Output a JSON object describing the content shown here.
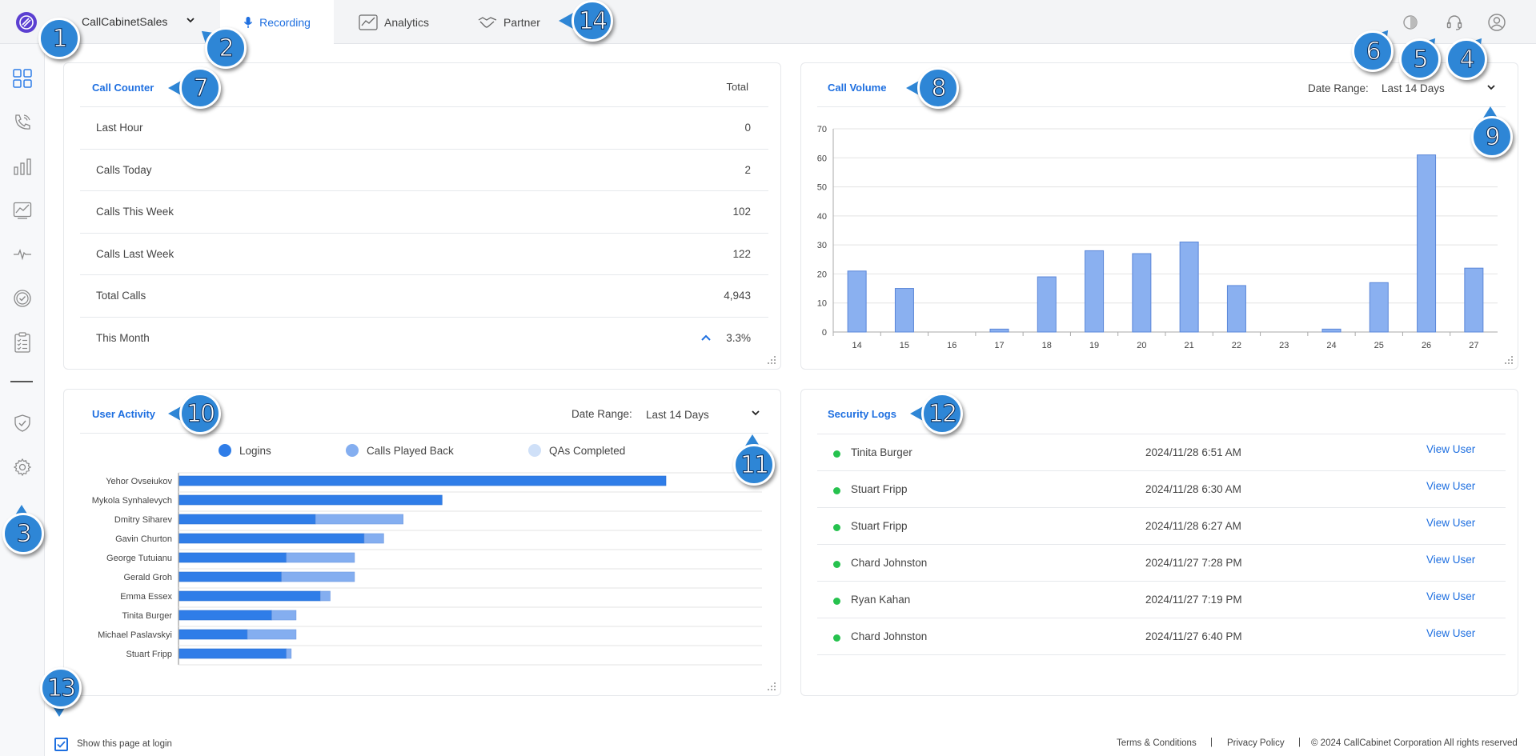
{
  "header": {
    "org_name": "CallCabinetSales",
    "tabs": [
      {
        "label": "Recording",
        "icon": "microphone-icon",
        "active": true
      },
      {
        "label": "Analytics",
        "icon": "analytics-chart-icon",
        "active": false
      },
      {
        "label": "Partner",
        "icon": "handshake-icon",
        "active": false
      }
    ],
    "right_icons": [
      "theme-toggle-icon",
      "headset-support-icon",
      "user-account-icon"
    ]
  },
  "sidebar": {
    "items": [
      "dashboard-grid-icon",
      "phone-calls-icon",
      "bar-chart-icon",
      "trend-chart-icon",
      "pulse-icon",
      "check-circle-icon",
      "checklist-icon",
      "shield-check-icon",
      "settings-gear-icon"
    ]
  },
  "call_counter": {
    "title": "Call Counter",
    "total_header": "Total",
    "rows": [
      {
        "label": "Last Hour",
        "value": "0"
      },
      {
        "label": "Calls Today",
        "value": "2"
      },
      {
        "label": "Calls This Week",
        "value": "102"
      },
      {
        "label": "Calls Last Week",
        "value": "122"
      },
      {
        "label": "Total Calls",
        "value": "4,943"
      },
      {
        "label": "This Month",
        "value": "3.3%",
        "trend": "up"
      }
    ]
  },
  "call_volume": {
    "title": "Call Volume",
    "date_range_label": "Date Range:",
    "date_range_value": "Last 14 Days"
  },
  "user_activity": {
    "title": "User Activity",
    "date_range_label": "Date Range:",
    "date_range_value": "Last 14 Days",
    "legend": [
      {
        "label": "Logins",
        "color": "#2f7de8"
      },
      {
        "label": "Calls Played Back",
        "color": "#84aef0"
      },
      {
        "label": "QAs Completed",
        "color": "#cfe0f8"
      }
    ]
  },
  "security_logs": {
    "title": "Security Logs",
    "link_label": "View User",
    "rows": [
      {
        "name": "Tinita Burger",
        "date": "2024/11/28 6:51 AM"
      },
      {
        "name": "Stuart Fripp",
        "date": "2024/11/28 6:30 AM"
      },
      {
        "name": "Stuart Fripp",
        "date": "2024/11/28 6:27 AM"
      },
      {
        "name": "Chard Johnston",
        "date": "2024/11/27 7:28 PM"
      },
      {
        "name": "Ryan Kahan",
        "date": "2024/11/27 7:19 PM"
      },
      {
        "name": "Chard Johnston",
        "date": "2024/11/27 6:40 PM"
      }
    ]
  },
  "footer": {
    "show_at_login": "Show this page at login",
    "show_at_login_checked": true,
    "terms": "Terms & Conditions",
    "privacy": "Privacy Policy",
    "separator": "|",
    "copyright": "© 2024 CallCabinet Corporation All rights reserved"
  },
  "callouts": [
    "1",
    "2",
    "3",
    "4",
    "5",
    "6",
    "7",
    "8",
    "9",
    "10",
    "11",
    "12",
    "13",
    "14"
  ],
  "colors": {
    "accent": "#1e6fe0",
    "bar": "#8ab0f0",
    "bar_stroke": "#5a86d8",
    "callout": "#2e86d6",
    "status_green": "#26c24e"
  },
  "chart_data": [
    {
      "type": "bar",
      "categories": [
        "14",
        "15",
        "16",
        "17",
        "18",
        "19",
        "20",
        "21",
        "22",
        "23",
        "24",
        "25",
        "26",
        "27"
      ],
      "values": [
        21,
        15,
        0,
        1,
        19,
        28,
        27,
        31,
        16,
        0,
        1,
        17,
        61,
        22
      ],
      "title": "Call Volume",
      "ylim": [
        0,
        70
      ],
      "yticks": [
        0,
        10,
        20,
        30,
        40,
        50,
        60,
        70
      ],
      "grid": true
    },
    {
      "type": "bar",
      "orientation": "horizontal",
      "stacked": true,
      "title": "User Activity",
      "categories": [
        "Yehor Ovseiukov",
        "Mykola Synhalevych",
        "Dmitry Siharev",
        "Gavin Churton",
        "George Tutuianu",
        "Gerald Groh",
        "Emma Essex",
        "Tinita Burger",
        "Michael Paslavskyi",
        "Stuart Fripp"
      ],
      "series": [
        {
          "name": "Logins",
          "values": [
            100,
            54,
            28,
            38,
            22,
            21,
            29,
            19,
            14,
            22
          ]
        },
        {
          "name": "Calls Played Back",
          "values": [
            0,
            0,
            18,
            4,
            14,
            15,
            2,
            5,
            10,
            1
          ]
        },
        {
          "name": "QAs Completed",
          "values": [
            0,
            0,
            0,
            0,
            0,
            0,
            0,
            0,
            0,
            0
          ]
        }
      ],
      "grid": true
    }
  ]
}
